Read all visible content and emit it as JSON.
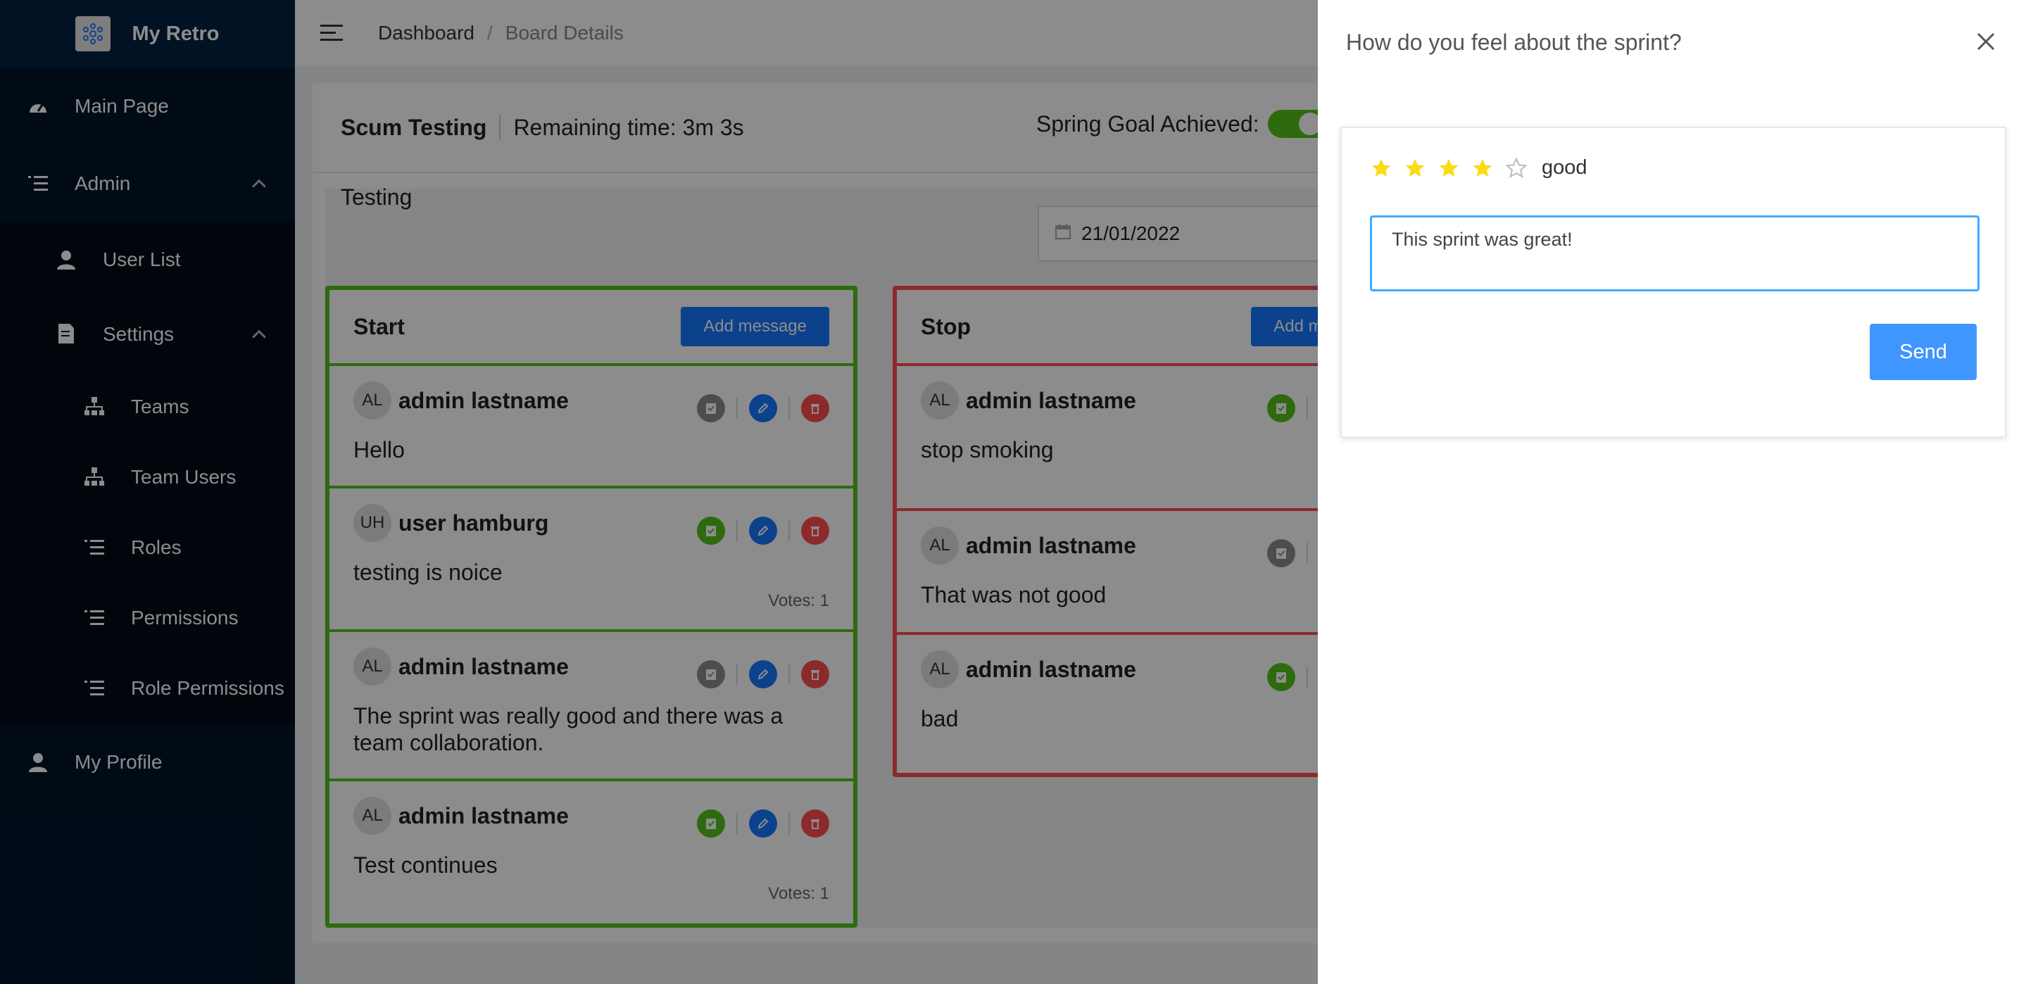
{
  "app": {
    "title": "My Retro"
  },
  "sidebar": {
    "items": [
      {
        "label": "Main Page",
        "icon": "dashboard-icon"
      },
      {
        "label": "Admin",
        "icon": "list-icon"
      },
      {
        "label": "User List",
        "icon": "user-icon"
      },
      {
        "label": "Settings",
        "icon": "file-icon"
      },
      {
        "label": "Teams",
        "icon": "hierarchy-icon"
      },
      {
        "label": "Team Users",
        "icon": "hierarchy-icon"
      },
      {
        "label": "Roles",
        "icon": "list-icon"
      },
      {
        "label": "Permissions",
        "icon": "list-icon"
      },
      {
        "label": "Role Permissions",
        "icon": "list-icon"
      },
      {
        "label": "My Profile",
        "icon": "user-icon"
      }
    ]
  },
  "header": {
    "breadcrumb": [
      "Dashboard",
      "Board Details"
    ],
    "separator": "/"
  },
  "board": {
    "name": "Scum Testing",
    "remaining": "Remaining time: 3m 3s",
    "goal_label": "Spring Goal Achieved:",
    "goal_achieved": true,
    "title": "Testing",
    "date": "21/01/2022"
  },
  "columns": [
    {
      "title": "Start",
      "add_label": "Add message",
      "color": "#52c41a",
      "cards": [
        {
          "initials": "AL",
          "author": "admin lastname",
          "text": "Hello",
          "votes": ""
        },
        {
          "initials": "UH",
          "author": "user hamburg",
          "text": "testing is noice",
          "votes": "Votes: 1"
        },
        {
          "initials": "AL",
          "author": "admin lastname",
          "text": "The sprint was really good and there was a team collaboration.",
          "votes": ""
        },
        {
          "initials": "AL",
          "author": "admin lastname",
          "text": "Test continues",
          "votes": "Votes: 1"
        }
      ]
    },
    {
      "title": "Stop",
      "add_label": "Add message",
      "color": "#ff4d4f",
      "cards": [
        {
          "initials": "AL",
          "author": "admin lastname",
          "text": "stop smoking",
          "votes": ""
        },
        {
          "initials": "AL",
          "author": "admin lastname",
          "text": "That was not good",
          "votes": ""
        },
        {
          "initials": "AL",
          "author": "admin lastname",
          "text": "bad",
          "votes": ""
        }
      ]
    }
  ],
  "drawer": {
    "title": "How do you feel about the sprint?",
    "rating": 4,
    "rating_max": 5,
    "rating_text": "good",
    "feedback_value": "This sprint was great!",
    "send_label": "Send"
  },
  "colors": {
    "sidebar": "#001529",
    "primary": "#1677ff",
    "star": "#fadb14"
  }
}
